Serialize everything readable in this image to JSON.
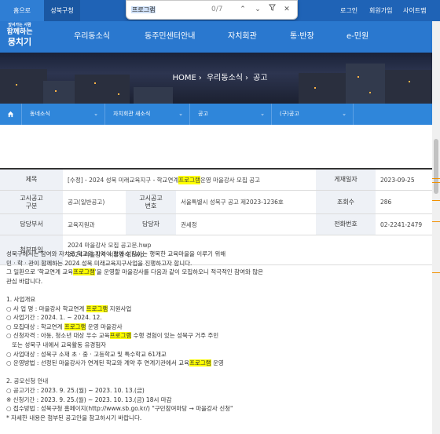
{
  "topbar": {
    "tab_home": "홈으로",
    "tab_sb": "성북구청",
    "links": [
      "로그인",
      "회원가입",
      "사이트맵"
    ]
  },
  "findbar": {
    "query": "프로그램",
    "count": "0/7",
    "icons": [
      "chevron-up-icon",
      "chevron-down-icon",
      "filter-icon",
      "close-icon"
    ]
  },
  "logo": {
    "line1": "앞서가는 사람",
    "line2": "함께하는",
    "line3": "뭉치기"
  },
  "gnb": [
    "우리동소식",
    "동주민센터안내",
    "자치회관",
    "통·반장",
    "e-민원"
  ],
  "breadcrumb": [
    "HOME",
    "우리동소식",
    "공고"
  ],
  "subnav": [
    "동네소식",
    "자치회관 새소식",
    "공고",
    "(구)공고"
  ],
  "table": {
    "title_label": "제목",
    "title_prefix": "[수정] - 2024 성북 미래교육지구 - 학교연계 ",
    "title_hl": "프로그램",
    "title_suffix": " 운영 마을강사 모집 공고",
    "date_label": "게재일자",
    "date_value": "2023-09-25",
    "type_label": "고시공고 구분",
    "type_value": "공고(일반공고)",
    "no_label": "고시공고 번호",
    "no_value": "서울특별시 성북구 공고 제2023-1236호",
    "views_label": "조회수",
    "views_value": "286",
    "dept_label": "담당부서",
    "dept_value": "교육지원과",
    "person_label": "담당자",
    "person_value": "권세정",
    "phone_label": "전화번호",
    "phone_value": "02-2241-2479",
    "file_label": "첨부파일",
    "files": [
      "2024 마을강사 모집 공고문.hwp",
      "2024 마을강사 서류양식.hwp"
    ]
  },
  "content": {
    "intro1": "성북구에서는 참여와 자치로 학교와 지역이 함께 성장하는 행복한 교육마을을 이루기 위해",
    "intro2": "민 · 학 · 관이 함께하는 2024 성북 미래교육지구사업을 진행하고자 합니다.",
    "intro3a": "그 일환으로 '학교연계 교육",
    "intro3b": "'을 운영할 마을강사를 다음과 같이 모집하오니 적극적인 참여와 많은",
    "intro4": "관심 바랍니다.",
    "s1_title": "1. 사업개요",
    "s1_name_a": "○ 사 업 명 : 마을강사 학교연계 ",
    "s1_name_b": " 지원사업",
    "s1_period": "○ 사업기간 : 2024. 1. ~ 2024. 12.",
    "s1_field_a": "○ 모집대상 : 학교연계 ",
    "s1_field_b": " 운영 마을강사",
    "s1_qual_a": "○ 신청자격 : 아동, 청소년 대상 우수 교육",
    "s1_qual_b": " 수행 경험이 있는 성북구 거주 주민",
    "s1_qual_c": "   또는 성북구 내에서 교육활동 유경험자",
    "s1_target": "○ 사업대상 : 성북구 소재 초 · 중 · 고등학교 및 특수학교 61개교",
    "s1_method_a": "○ 운영방법 : 선정된 마을강사가 연계된 학교와 계약 후 연계기관에서 교육",
    "s1_method_b": " 운영",
    "s2_title": "2. 공모신청 안내",
    "s2_notice": "○ 공고기간 : 2023. 9. 25.(월) ~ 2023. 10. 13.(금)",
    "s2_deadline": "※ 신청기간 : 2023. 9. 25.(월) ~ 2023. 10. 13.(금) 18시 마감",
    "s2_apply": "○ 접수방법 : 성북구청 홈페이지(http://www.sb.go.kr/) \"구민참여마당 → 마을강사 신청\"",
    "s2_more": "* 자세한 내용은 첨부된 공고안을 참고하시기 바랍니다."
  },
  "colors": {
    "topbar": "#1f63b6",
    "header": "#2a78cf",
    "subnav": "#2f86da",
    "highlight": "#ffff00"
  }
}
